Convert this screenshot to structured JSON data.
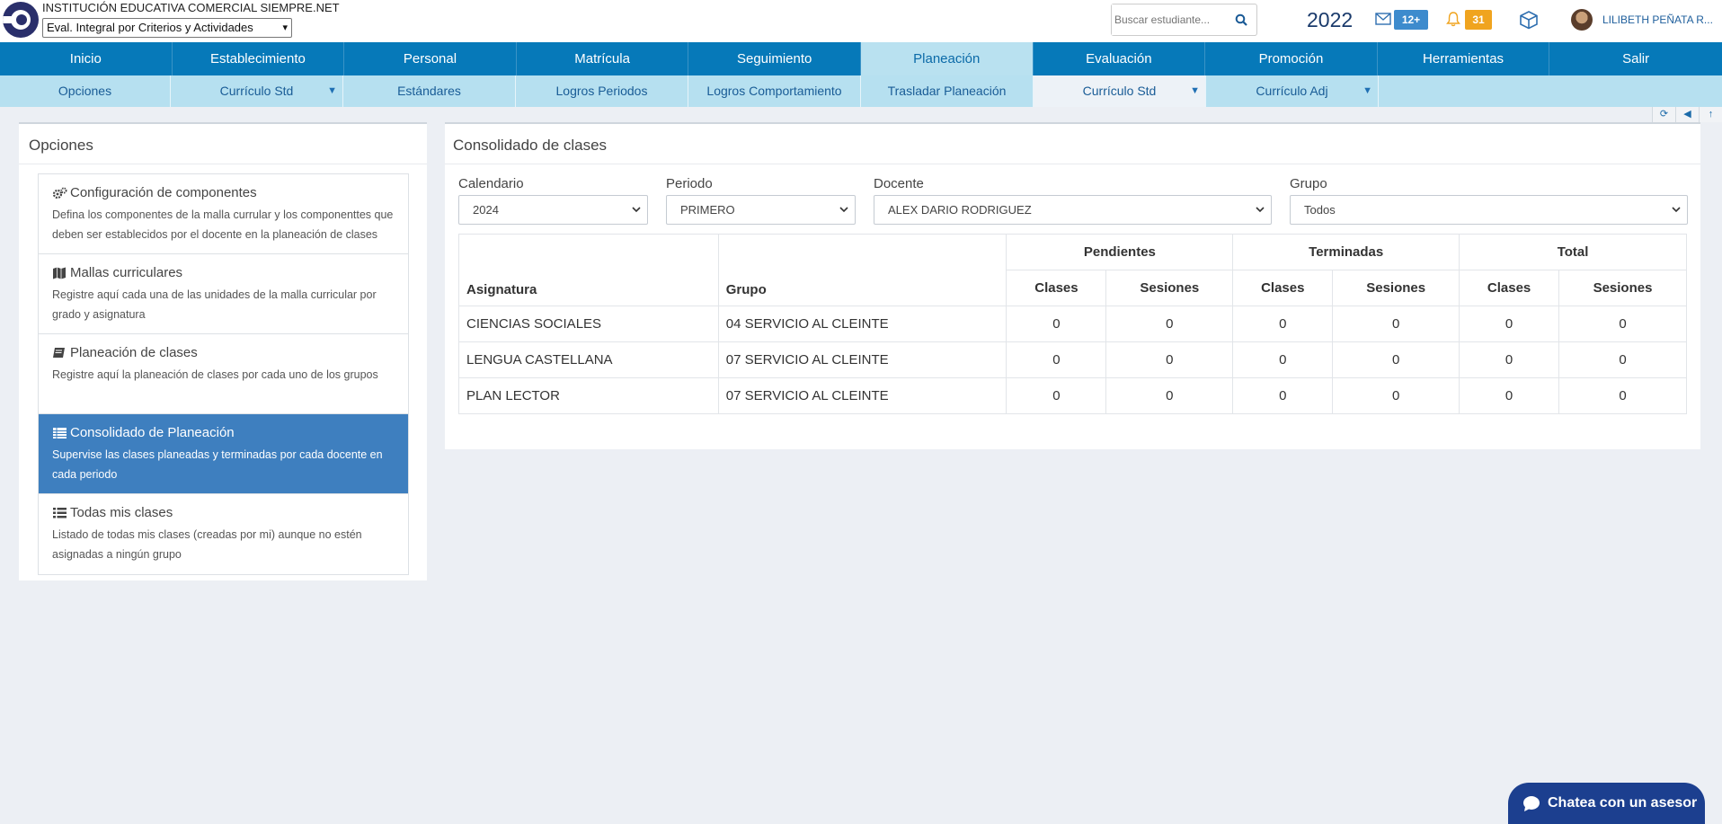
{
  "header": {
    "institution": "INSTITUCIÓN EDUCATIVA COMERCIAL SIEMPRE.NET",
    "mode_select": "Eval. Integral por Criterios y Actividades",
    "search_placeholder": "Buscar estudiante...",
    "year": "2022",
    "messages_badge": "12+",
    "notifications_badge": "31",
    "user_name": "LILIBETH PEÑATA R..."
  },
  "nav": {
    "items": [
      "Inicio",
      "Establecimiento",
      "Personal",
      "Matrícula",
      "Seguimiento",
      "Planeación",
      "Evaluación",
      "Promoción",
      "Herramientas",
      "Salir"
    ],
    "active": "Planeación"
  },
  "subnav": {
    "items": [
      "Opciones",
      "Currículo Std",
      "Estándares",
      "Logros Periodos",
      "Logros Comportamiento",
      "Trasladar Planeación",
      "Currículo Std",
      "Currículo Adj"
    ]
  },
  "options_panel": {
    "title": "Opciones",
    "items": [
      {
        "title": "Configuración de componentes",
        "desc": "Defina los componentes de la malla currular y los componenttes que deben ser establecidos por el docente en la planeación de clases",
        "icon": "gears-icon"
      },
      {
        "title": "Mallas curriculares",
        "desc": "Registre aquí cada una de las unidades de la malla curricular por grado y asignatura",
        "icon": "map-icon"
      },
      {
        "title": "Planeación de clases",
        "desc": "Registre aquí la planeación de clases por cada uno de los grupos",
        "icon": "book-icon"
      },
      {
        "title": "Consolidado de Planeación",
        "desc": "Supervise las clases planeadas y terminadas por cada docente en cada periodo",
        "icon": "table-icon"
      },
      {
        "title": "Todas mis clases",
        "desc": "Listado de todas mis clases (creadas por mi) aunque no estén asignadas a ningún grupo",
        "icon": "list-icon"
      }
    ]
  },
  "consolidado": {
    "title": "Consolidado de clases",
    "filters": {
      "calendario_label": "Calendario",
      "calendario_value": "2024",
      "periodo_label": "Periodo",
      "periodo_value": "PRIMERO",
      "docente_label": "Docente",
      "docente_value": "ALEX DARIO RODRIGUEZ",
      "grupo_label": "Grupo",
      "grupo_value": "Todos"
    },
    "table": {
      "group_headers": [
        "Pendientes",
        "Terminadas",
        "Total"
      ],
      "col_asignatura": "Asignatura",
      "col_grupo": "Grupo",
      "col_clases": "Clases",
      "col_sesiones": "Sesiones",
      "rows": [
        {
          "asignatura": "CIENCIAS SOCIALES",
          "grupo": "04 SERVICIO AL CLEINTE",
          "v": [
            "0",
            "0",
            "0",
            "0",
            "0",
            "0"
          ]
        },
        {
          "asignatura": "LENGUA CASTELLANA",
          "grupo": "07 SERVICIO AL CLEINTE",
          "v": [
            "0",
            "0",
            "0",
            "0",
            "0",
            "0"
          ]
        },
        {
          "asignatura": "PLAN LECTOR",
          "grupo": "07 SERVICIO AL CLEINTE",
          "v": [
            "0",
            "0",
            "0",
            "0",
            "0",
            "0"
          ]
        }
      ]
    }
  },
  "chat": {
    "label": "Chatea con un asesor"
  },
  "colors": {
    "nav": "#0679b9",
    "subnav": "#b6e0f0",
    "active_option": "#3e7fbf",
    "chat": "#1c3f8f"
  }
}
